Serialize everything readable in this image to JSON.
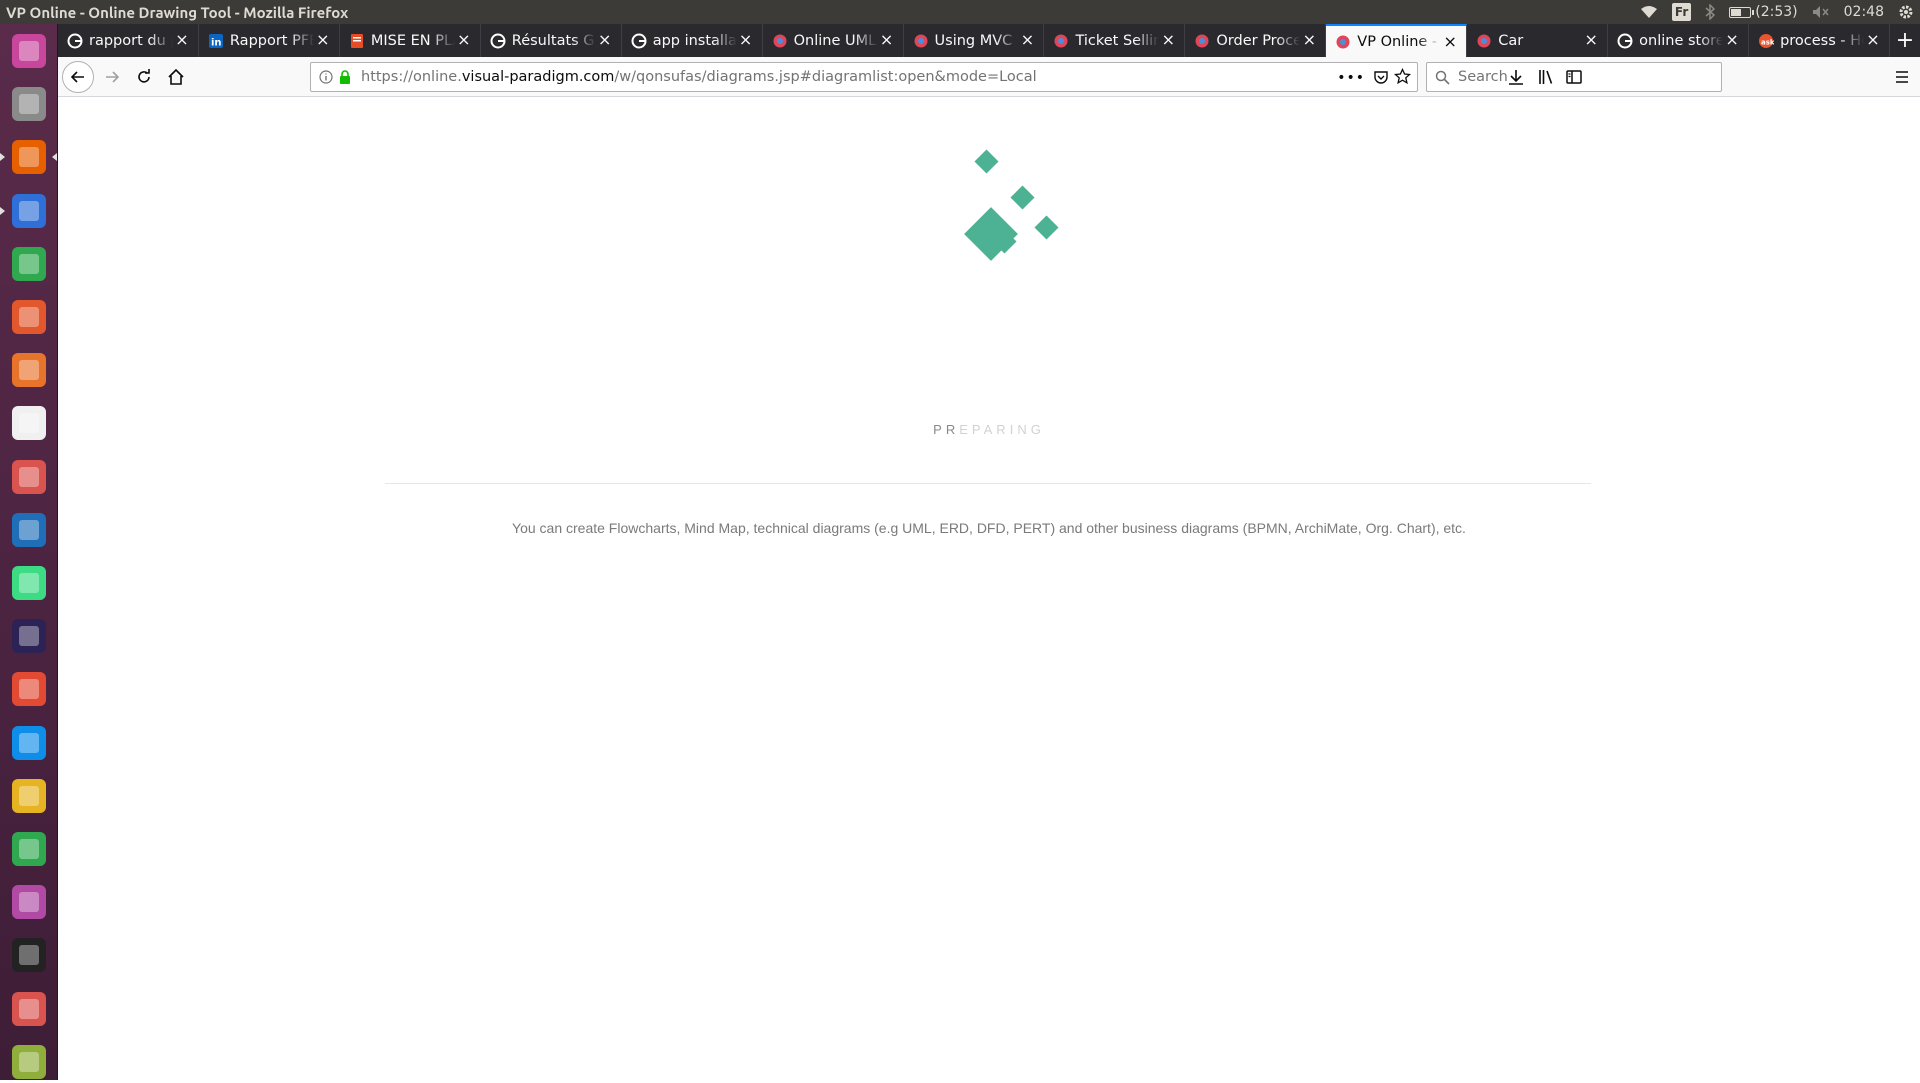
{
  "window": {
    "title": "VP Online - Online Drawing Tool - Mozilla Firefox"
  },
  "system": {
    "keyboard_layout": "Fr",
    "battery_text": "(2:53)",
    "battery_level_fraction": 0.6,
    "clock": "02:48"
  },
  "launcher": {
    "items": [
      {
        "name": "dash-home-icon",
        "color": "#c8469b"
      },
      {
        "name": "files-icon",
        "color": "#8a8a8a"
      },
      {
        "name": "firefox-icon",
        "color": "#e66000"
      },
      {
        "name": "wps-writer-icon",
        "color": "#2f6fd8"
      },
      {
        "name": "wps-spreadsheets-icon",
        "color": "#2fa84f"
      },
      {
        "name": "wps-presentation-icon",
        "color": "#e2572c"
      },
      {
        "name": "software-center-icon",
        "color": "#e8742c"
      },
      {
        "name": "amazon-icon",
        "color": "#f0f0f0"
      },
      {
        "name": "system-settings-icon",
        "color": "#d9534f"
      },
      {
        "name": "vscode-icon",
        "color": "#1e6fb8"
      },
      {
        "name": "android-studio-icon",
        "color": "#3ddc84"
      },
      {
        "name": "eclipse-icon",
        "color": "#2c2255"
      },
      {
        "name": "git-icon",
        "color": "#e24a33"
      },
      {
        "name": "teamviewer-icon",
        "color": "#0e8ee9"
      },
      {
        "name": "puzzle-app-icon",
        "color": "#e6b422"
      },
      {
        "name": "ring-app-icon",
        "color": "#2fa84f"
      },
      {
        "name": "window-app-icon",
        "color": "#b04aa5"
      },
      {
        "name": "inkscape-icon",
        "color": "#222222"
      },
      {
        "name": "document-viewer-icon",
        "color": "#d9534f"
      },
      {
        "name": "scanner-icon",
        "color": "#8fae3c"
      }
    ]
  },
  "tabs": [
    {
      "label": "rapport du projet",
      "icon": "google-icon",
      "active": false
    },
    {
      "label": "Rapport PFE",
      "icon": "linkedin-icon",
      "active": false
    },
    {
      "label": "MISE EN PLACE",
      "icon": "doc-icon",
      "active": false
    },
    {
      "label": "Résultats Google",
      "icon": "google-icon",
      "active": false
    },
    {
      "label": "app installation",
      "icon": "google-icon",
      "active": false
    },
    {
      "label": "Online UML",
      "icon": "vp-icon",
      "active": false
    },
    {
      "label": "Using MVC",
      "icon": "vp-icon",
      "active": false
    },
    {
      "label": "Ticket Selling",
      "icon": "vp-icon",
      "active": false
    },
    {
      "label": "Order Process",
      "icon": "vp-icon",
      "active": false
    },
    {
      "label": "VP Online - Online",
      "icon": "vp-icon",
      "active": true
    },
    {
      "label": "Car",
      "icon": "vp-icon",
      "active": false
    },
    {
      "label": "online store",
      "icon": "google-icon",
      "active": false
    },
    {
      "label": "process - How",
      "icon": "ask-icon",
      "active": false
    }
  ],
  "nav": {
    "url_prefix": "https://online.",
    "url_host": "visual-paradigm.com",
    "url_path": "/w/qonsufas/diagrams.jsp#diagramlist:open&mode=Local",
    "search_placeholder": "Search"
  },
  "page": {
    "loading_status": "PREPARING",
    "loading_highlight_count": 2,
    "tagline": "You can create Flowcharts, Mind Map, technical diagrams (e.g UML, ERD, DFD, PERT) and other business diagrams (BPMN, ArchiMate, Org. Chart), etc.",
    "accent_color": "#4cb293"
  }
}
